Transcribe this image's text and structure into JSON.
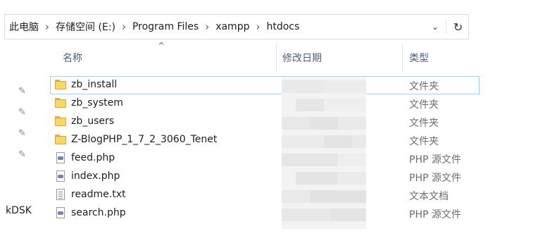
{
  "address_bar": {
    "crumbs": [
      "此电脑",
      "存储空间 (E:)",
      "Program Files",
      "xampp",
      "htdocs"
    ],
    "separator": "›",
    "dropdown_glyph": "⌄",
    "refresh_glyph": "↻"
  },
  "columns": {
    "name": "名称",
    "date_modified": "修改日期",
    "type": "类型",
    "sort_glyph": "^"
  },
  "sidebar": {
    "pin_glyph": "📌",
    "partial_item": "kDSK"
  },
  "files": [
    {
      "name": "zb_install",
      "type": "文件夹",
      "icon": "folder-icon"
    },
    {
      "name": "zb_system",
      "type": "文件夹",
      "icon": "folder-icon"
    },
    {
      "name": "zb_users",
      "type": "文件夹",
      "icon": "folder-icon"
    },
    {
      "name": "Z-BlogPHP_1_7_2_3060_Tenet",
      "type": "文件夹",
      "icon": "folder-icon"
    },
    {
      "name": "feed.php",
      "type": "PHP 源文件",
      "icon": "php-file-icon"
    },
    {
      "name": "index.php",
      "type": "PHP 源文件",
      "icon": "php-file-icon"
    },
    {
      "name": "readme.txt",
      "type": "文本文档",
      "icon": "text-file-icon"
    },
    {
      "name": "search.php",
      "type": "PHP 源文件",
      "icon": "php-file-icon"
    }
  ]
}
